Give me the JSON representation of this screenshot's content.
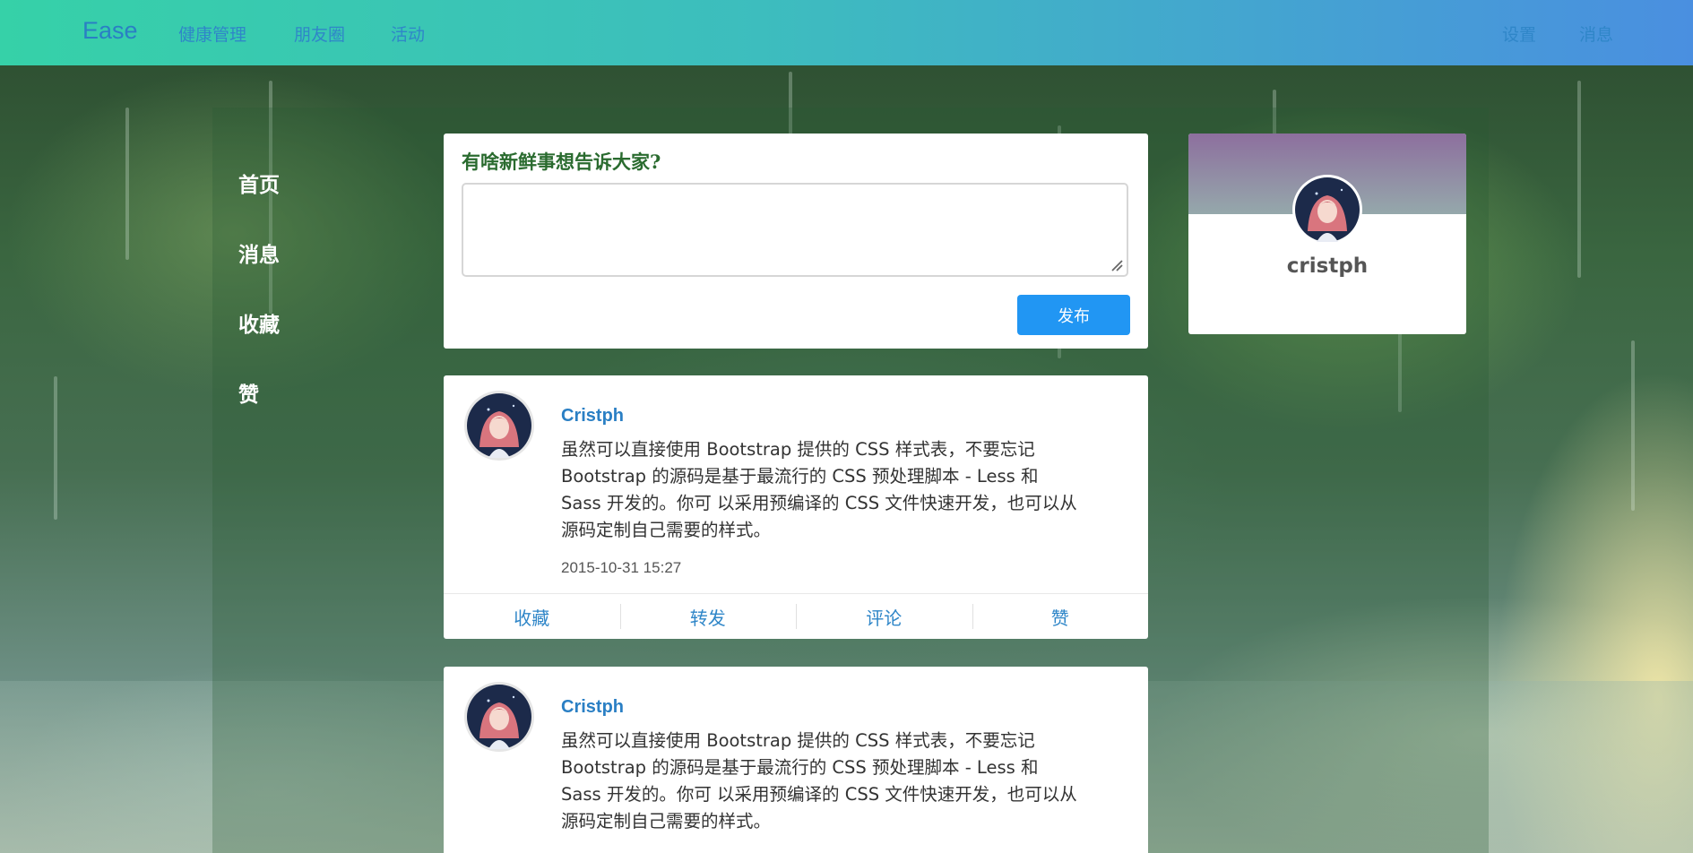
{
  "navbar": {
    "brand": "Ease",
    "links": [
      "健康管理",
      "朋友圈",
      "活动"
    ],
    "right_links": [
      "设置",
      "消息"
    ]
  },
  "sidebar": {
    "items": [
      "首页",
      "消息",
      "收藏",
      "赞"
    ]
  },
  "composer": {
    "title": "有啥新鲜事想告诉大家?",
    "input_value": "",
    "publish_label": "发布"
  },
  "profile": {
    "name": "cristph",
    "avatar_icon": "anime-girl-avatar"
  },
  "feed": {
    "posts": [
      {
        "author": "Cristph",
        "body": "虽然可以直接使用 Bootstrap 提供的 CSS 样式表，不要忘记 Bootstrap 的源码是基于最流行的 CSS 预处理脚本 - Less 和 Sass 开发的。你可 以采用预编译的 CSS 文件快速开发，也可以从源码定制自己需要的样式。",
        "time": "2015-10-31 15:27",
        "actions": [
          "收藏",
          "转发",
          "评论",
          "赞"
        ]
      },
      {
        "author": "Cristph",
        "body": "虽然可以直接使用 Bootstrap 提供的 CSS 样式表，不要忘记 Bootstrap 的源码是基于最流行的 CSS 预处理脚本 - Less 和 Sass 开发的。你可 以采用预编译的 CSS 文件快速开发，也可以从源码定制自己需要的样式。"
      }
    ]
  },
  "colors": {
    "nav_gradient_start": "#36d1a8",
    "nav_gradient_end": "#4a8fe0",
    "link": "#2f86c8",
    "publish_button": "#2196f3"
  }
}
